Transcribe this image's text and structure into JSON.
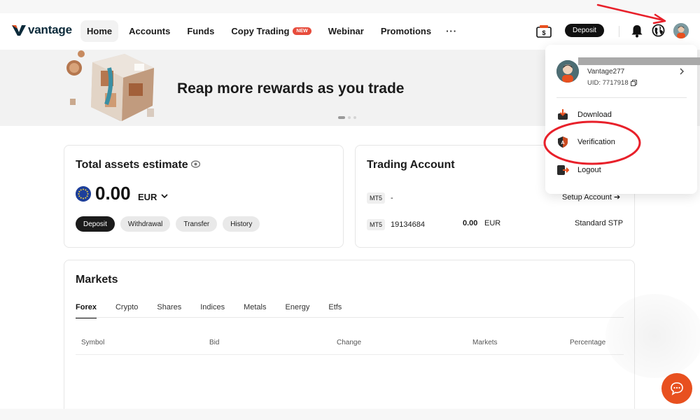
{
  "brand": {
    "name": "vantage",
    "accent": "#e8501f",
    "dark": "#1b1b1b"
  },
  "nav": {
    "items": [
      {
        "label": "Home",
        "active": true
      },
      {
        "label": "Accounts"
      },
      {
        "label": "Funds"
      },
      {
        "label": "Copy Trading",
        "badge": "NEW"
      },
      {
        "label": "Webinar"
      },
      {
        "label": "Promotions"
      }
    ],
    "more": "···"
  },
  "header": {
    "deposit_label": "Deposit",
    "icons": [
      "ticket-icon",
      "bell-icon",
      "globe-icon",
      "avatar"
    ]
  },
  "banner": {
    "title": "Reap more rewards as you trade",
    "slides": 3,
    "active_slide": 1
  },
  "assets": {
    "title": "Total assets estimate",
    "amount": "0.00",
    "currency": "EUR",
    "buttons": [
      "Deposit",
      "Withdrawal",
      "Transfer",
      "History"
    ]
  },
  "trading": {
    "title": "Trading Account",
    "rows": [
      {
        "platform": "MT5",
        "account": "-",
        "action": "Setup Account ➔"
      },
      {
        "platform": "MT5",
        "account": "19134684",
        "balance": "0.00",
        "currency": "EUR",
        "type": "Standard STP"
      }
    ]
  },
  "markets": {
    "title": "Markets",
    "tabs": [
      "Forex",
      "Crypto",
      "Shares",
      "Indices",
      "Metals",
      "Energy",
      "Etfs"
    ],
    "active_tab": "Forex",
    "columns": [
      "Symbol",
      "Bid",
      "Change",
      "Markets",
      "Percentage"
    ]
  },
  "dropdown": {
    "username": "Vantage277",
    "uid": "UID: 7717918",
    "items": [
      "Download",
      "Verification",
      "Logout"
    ]
  }
}
